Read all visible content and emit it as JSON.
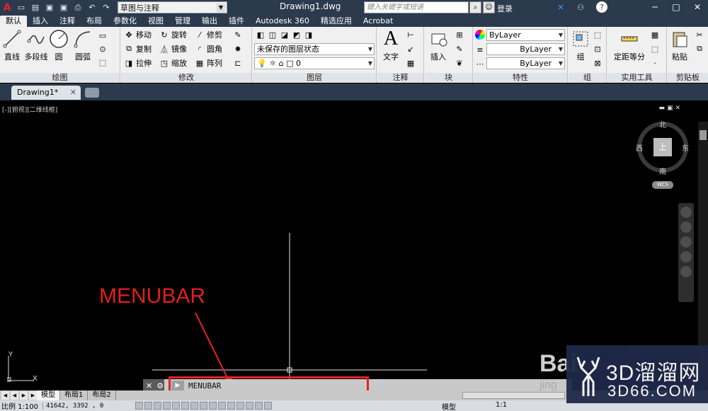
{
  "titlebar": {
    "logo": "A",
    "workspace": "草图与注释",
    "document_title": "Drawing1.dwg",
    "search_placeholder": "键入关键字或短语",
    "login": "登录",
    "help": "?"
  },
  "ribbon_tabs": [
    "默认",
    "插入",
    "注释",
    "布局",
    "参数化",
    "视图",
    "管理",
    "输出",
    "插件",
    "Autodesk 360",
    "精选应用",
    "Acrobat"
  ],
  "ribbon": {
    "draw": {
      "label": "绘图",
      "line": "直线",
      "polyline": "多段线",
      "circle": "圆",
      "arc": "圆弧"
    },
    "modify": {
      "label": "修改",
      "move": "移动",
      "rotate": "旋转",
      "trim": "修剪",
      "copy": "复制",
      "mirror": "镜像",
      "fillet": "圆角",
      "stretch": "拉伸",
      "scale": "缩放",
      "array": "阵列"
    },
    "layers": {
      "label": "图层",
      "state": "未保存的图层状态",
      "current": "0"
    },
    "annotation": {
      "label": "注释",
      "text": "文字"
    },
    "block": {
      "label": "块",
      "insert": "插入"
    },
    "properties": {
      "label": "特性",
      "color": "ByLayer",
      "linetype": "ByLayer",
      "lineweight": "ByLayer"
    },
    "groups": {
      "label": "组",
      "group": "组"
    },
    "utilities": {
      "label": "实用工具",
      "measure": "定距等分"
    },
    "clipboard": {
      "label": "剪贴板",
      "paste": "粘贴"
    }
  },
  "file_tab": "Drawing1*",
  "viewport": {
    "label": "[-][俯视][二维线框]",
    "compass": {
      "north": "北",
      "south": "南",
      "east": "东",
      "west": "西",
      "top": "上"
    },
    "wcs": "WCS",
    "ucs_y": "Y",
    "ucs_x": "X"
  },
  "annotation_label": "MENUBAR",
  "command_line": {
    "input": "MENUBAR"
  },
  "layout_tabs": [
    "模型",
    "布局1",
    "布局2"
  ],
  "status": {
    "scale": "比例 1:100",
    "coords": "41642, 3392 , 0",
    "model": "模型",
    "annot_scale": "1:1"
  },
  "watermark": {
    "baidu": "Bai",
    "baidu2": "jing",
    "logo_cn": "3D溜溜网",
    "logo_en": "3D66.COM"
  }
}
